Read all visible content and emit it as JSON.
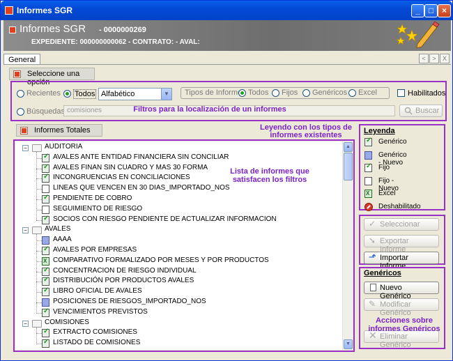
{
  "window": {
    "title": "Informes SGR"
  },
  "header": {
    "title": "Informes SGR",
    "number": "- 0000000269",
    "subtitle": "EXPEDIENTE: 000000000062 - CONTRATO:  - AVAL:"
  },
  "tabs": [
    {
      "label": "General",
      "active": true
    }
  ],
  "tab_nav": [
    "<",
    ">",
    "X"
  ],
  "section_header": "Seleccione una opción",
  "filters": {
    "recientes_label": "Recientes",
    "todos_label": "Todos",
    "sort_value": "Alfabético",
    "tipos_label": "Tipos de Informe",
    "tipos_options": [
      "Todos",
      "Fijos",
      "Genéricos",
      "Excel"
    ],
    "tipos_selected": "Todos",
    "habilitados_label": "Habilitados",
    "busquedas_label": "Búsquedas",
    "search_value": "comisiones",
    "buscar_label": "Buscar",
    "annotation": "Filtros para la localización de un informes"
  },
  "tree_header": "Informes Totales",
  "annotations": {
    "legend": "Leyendo con los tipos de informes existentes",
    "list": "Lista de informes que satisfacen los filtros",
    "generic_actions": "Acciones sobre informes Genéricos"
  },
  "tree": {
    "groups": [
      {
        "label": "AUDITORIA",
        "items": [
          {
            "label": "AVALES ANTE ENTIDAD FINANCIERA SIN CONCILIAR",
            "type": "generico"
          },
          {
            "label": "AVALES FINAN SIN CUADRO Y MAS 30 FORMA",
            "type": "generico"
          },
          {
            "label": "INCONGRUENCIAS EN CONCILIACIONES",
            "type": "generico"
          },
          {
            "label": "LINEAS QUE VENCEN EN 30 DIAS_IMPORTADO_NOS",
            "type": "fijo-nuevo"
          },
          {
            "label": "PENDIENTE DE COBRO",
            "type": "generico"
          },
          {
            "label": "SEGUIMIENTO DE RIESGO",
            "type": "fijo-nuevo"
          },
          {
            "label": "SOCIOS CON RIESGO PENDIENTE DE ACTUALIZAR INFORMACION",
            "type": "generico"
          }
        ]
      },
      {
        "label": "AVALES",
        "items": [
          {
            "label": "AAAA",
            "type": "generico-nuevo"
          },
          {
            "label": "AVALES POR EMPRESAS",
            "type": "generico"
          },
          {
            "label": "COMPARATIVO FORMALIZADO POR MESES Y POR PRODUCTOS",
            "type": "excel"
          },
          {
            "label": "CONCENTRACION DE RIESGO INDIVIDUAL",
            "type": "generico"
          },
          {
            "label": "DISTRIBUCIÓN POR PRODUCTOS AVALES",
            "type": "generico"
          },
          {
            "label": "LIBRO OFICIAL DE AVALES",
            "type": "generico"
          },
          {
            "label": "POSICIONES DE RIESGOS_IMPORTADO_NOS",
            "type": "generico-nuevo"
          },
          {
            "label": "VENCIMIENTOS PREVISTOS",
            "type": "generico"
          }
        ]
      },
      {
        "label": "COMISIONES",
        "items": [
          {
            "label": "EXTRACTO COMISIONES",
            "type": "generico"
          },
          {
            "label": "LISTADO DE COMISIONES",
            "type": "generico"
          }
        ]
      }
    ]
  },
  "legend": {
    "title": "Leyenda",
    "items": [
      {
        "label": "Genérico",
        "icon": "generico-icon"
      },
      {
        "label": "Genérico - Nuevo",
        "icon": "generico-nuevo-icon"
      },
      {
        "label": "Fijo",
        "icon": "fijo-icon"
      },
      {
        "label": "Fijo - Nuevo",
        "icon": "fijo-nuevo-icon"
      },
      {
        "label": "Excel",
        "icon": "excel-icon"
      },
      {
        "label": "Deshabilitado",
        "icon": "deshabilitado-icon"
      }
    ]
  },
  "actions": {
    "seleccionar": "Seleccionar",
    "exportar": "Exportar Informe",
    "importar": "Importar Informe"
  },
  "genericos": {
    "title": "Genéricos",
    "nuevo": "Nuevo Genérico",
    "modificar": "Modificar Genérico",
    "eliminar": "Eliminar Genérico"
  },
  "colors": {
    "annotation": "#9b30c8",
    "titlebar": "#0349d6",
    "header": "#7d7d7d"
  }
}
